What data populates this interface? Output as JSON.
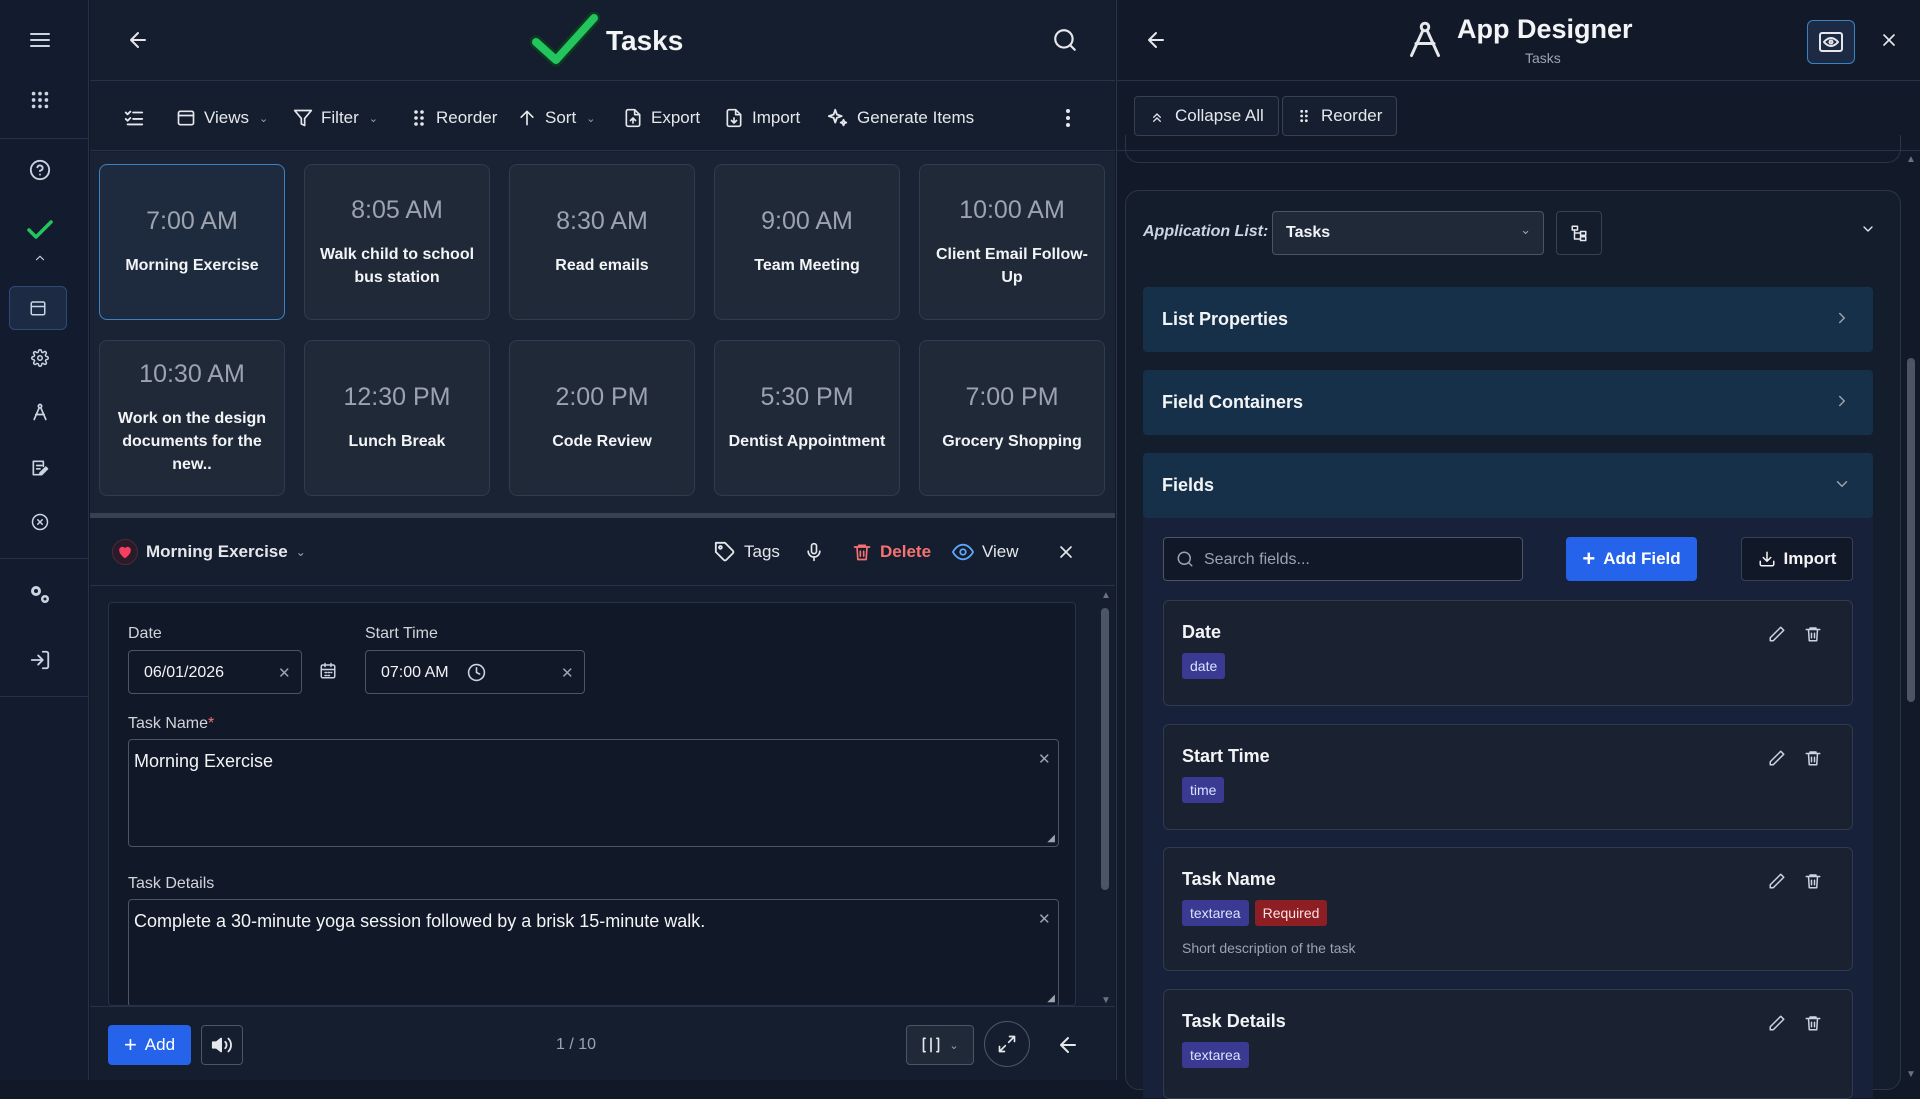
{
  "tasks_panel": {
    "title": "Tasks",
    "toolbar": {
      "views": "Views",
      "filter": "Filter",
      "reorder": "Reorder",
      "sort": "Sort",
      "export": "Export",
      "import": "Import",
      "generate": "Generate Items"
    },
    "cards": [
      {
        "time": "7:00 AM",
        "name": "Morning Exercise"
      },
      {
        "time": "8:05 AM",
        "name": "Walk child to school bus station"
      },
      {
        "time": "8:30 AM",
        "name": "Read emails"
      },
      {
        "time": "9:00 AM",
        "name": "Team Meeting"
      },
      {
        "time": "10:00 AM",
        "name": "Client Email Follow-Up"
      },
      {
        "time": "10:30 AM",
        "name": "Work on the design documents for the new.."
      },
      {
        "time": "12:30 PM",
        "name": "Lunch Break"
      },
      {
        "time": "2:00 PM",
        "name": "Code Review"
      },
      {
        "time": "5:30 PM",
        "name": "Dentist Appointment"
      },
      {
        "time": "7:00 PM",
        "name": "Grocery Shopping"
      }
    ],
    "detail": {
      "title": "Morning Exercise",
      "tags": "Tags",
      "delete": "Delete",
      "view": "View",
      "date_label": "Date",
      "date_value": "06/01/2026",
      "start_label": "Start Time",
      "start_value": "07:00 AM",
      "name_label": "Task Name",
      "name_required": "*",
      "name_value": "Morning Exercise",
      "details_label": "Task Details",
      "details_value": "Complete a 30-minute yoga session followed by a brisk 15-minute walk."
    },
    "bottom": {
      "add": "Add",
      "pager": "1 / 10"
    }
  },
  "designer": {
    "title": "App Designer",
    "subtitle": "Tasks",
    "collapse_all": "Collapse All",
    "reorder": "Reorder",
    "app_list_label": "Application List:",
    "app_list_value": "Tasks",
    "sections": {
      "list_properties": "List Properties",
      "field_containers": "Field Containers",
      "fields": "Fields"
    },
    "search_placeholder": "Search fields...",
    "add_field": "Add Field",
    "import": "Import",
    "fields": [
      {
        "name": "Date",
        "type": "date"
      },
      {
        "name": "Start Time",
        "type": "time"
      },
      {
        "name": "Task Name",
        "type": "textarea",
        "required": "Required",
        "description": "Short description of the task"
      },
      {
        "name": "Task Details",
        "type": "textarea"
      }
    ]
  },
  "colors": {
    "accent_green": "#22c55e",
    "accent_blue": "#2563eb",
    "delete_red": "#f87171",
    "section_bg": "#17304a",
    "required_tag": "#8d1e24",
    "type_tag": "#3a3a93"
  }
}
